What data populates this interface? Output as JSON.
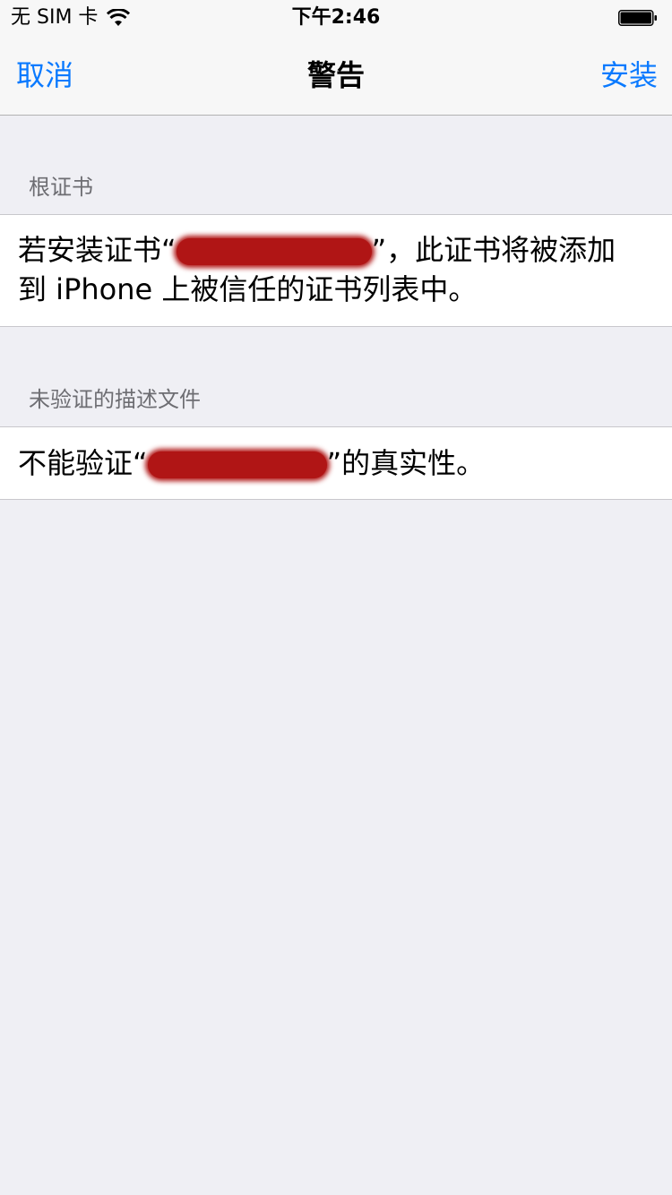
{
  "status": {
    "carrier": "无 SIM 卡",
    "time": "下午2:46"
  },
  "nav": {
    "cancel": "取消",
    "title": "警告",
    "install": "安装"
  },
  "sections": [
    {
      "header": "根证书",
      "line1_prefix": "若安装证书“",
      "line1_suffix": "”，此证书将被添加",
      "line2": "到 iPhone 上被信任的证书列表中。"
    },
    {
      "header": "未验证的描述文件",
      "line1_prefix": "不能验证“",
      "line1_suffix": "”的真实性。"
    }
  ],
  "colors": {
    "accent": "#0a7aff",
    "background": "#efeff4",
    "redaction": "#b01515"
  }
}
